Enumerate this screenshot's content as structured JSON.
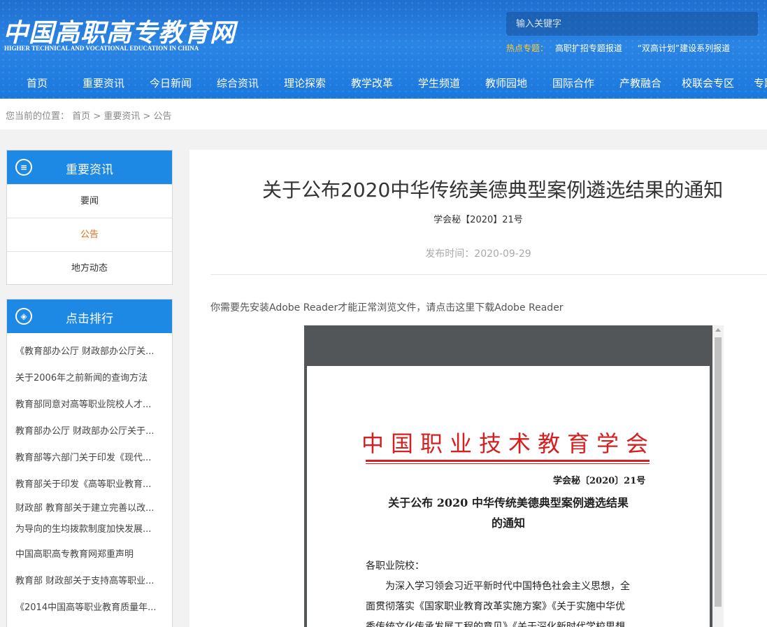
{
  "header": {
    "logo_cn": "中国高职高专教育网",
    "logo_en": "HIGHER TECHNICAL AND VOCATIONAL EDUCATION IN CHINA",
    "search_placeholder": "输入关键字",
    "hot_label": "热点专题：",
    "hot_links": [
      "高职扩招专题报道",
      "“双高计划”建设系列报道"
    ],
    "nav": [
      "首页",
      "重要资讯",
      "今日新闻",
      "综合资讯",
      "理论探索",
      "教学改革",
      "学生频道",
      "教师园地",
      "国际合作",
      "产教融合",
      "校联会专区",
      "专题"
    ]
  },
  "breadcrumb": {
    "prefix": "您当前的位置：",
    "items": [
      "首页",
      "重要资讯",
      "公告"
    ],
    "separator": " > "
  },
  "sidebar": {
    "category_title": "重要资讯",
    "category_icon": "menu-list-icon",
    "menu": [
      {
        "label": "要闻",
        "active": false
      },
      {
        "label": "公告",
        "active": true
      },
      {
        "label": "地方动态",
        "active": false
      }
    ],
    "ranking_title": "点击排行",
    "ranking_icon": "diamond-grid-icon",
    "ranking": [
      "《教育部办公厅 财政部办公厅关...",
      "关于2006年之前新闻的查询方法",
      "教育部同意对高等职业院校人才...",
      "教育部办公厅 财政部办公厅关于...",
      "教育部等六部门关于印发《现代...",
      "教育部关于印发《高等职业教育...",
      "财政部 教育部关于建立完善以改革和绩效为导向的生均拨款制度加快发展...",
      "中国高职高专教育网郑重声明",
      "教育部 财政部关于支持高等职业...",
      "《2014中国高等职业教育质量年..."
    ],
    "ranking_tall_lines": [
      "财政部 教育部关于建立完善以改...",
      "为导向的生均拨款制度加快发展..."
    ]
  },
  "article": {
    "title": "关于公布2020中华传统美德典型案例遴选结果的通知",
    "doc_number": "学会秘【2020】21号",
    "publish_time": "发布时间：2020-09-29",
    "adobe_notice": "你需要先安装Adobe Reader才能正常浏览文件，请点击这里下载Adobe Reader"
  },
  "pdf": {
    "org": "中国职业技术教育学会",
    "doc_number": "学会秘〔2020〕21号",
    "title_line1": "关于公布 2020 中华传统美德典型案例遴选结果",
    "title_line2": "的通知",
    "body": [
      "各职业院校：",
      "为深入学习领会习近平新时代中国特色社会主义思想，全",
      "面贯彻落实《国家职业教育改革实施方案》《关于实施中华优",
      "秀传统文化传承发展工程的意见》《关于深化新时代学校思想"
    ]
  },
  "colors": {
    "header_blue": "#1e78dd",
    "sidebar_head": "#1e88e5",
    "active_menu": "#e36b16",
    "hot_label": "#ffcc33",
    "pdf_red": "#d42020"
  }
}
